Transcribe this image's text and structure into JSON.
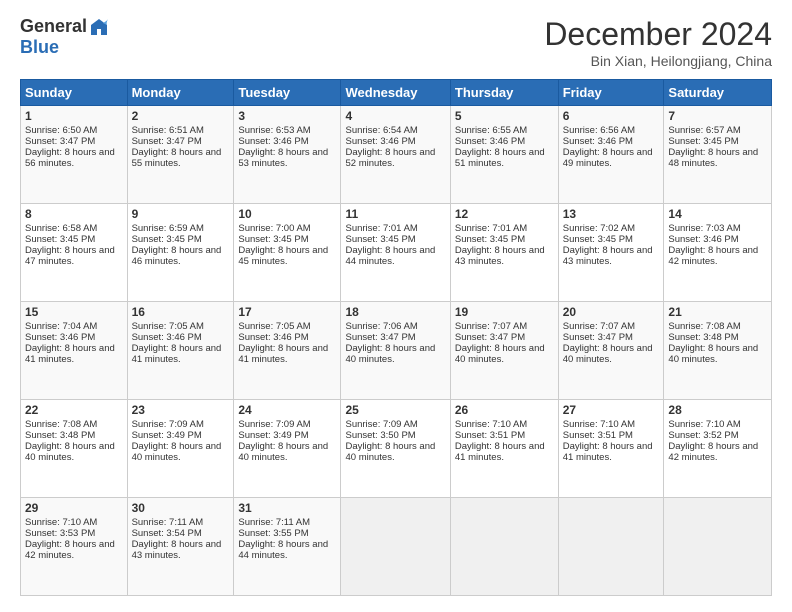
{
  "logo": {
    "general": "General",
    "blue": "Blue"
  },
  "header": {
    "month": "December 2024",
    "location": "Bin Xian, Heilongjiang, China"
  },
  "columns": [
    "Sunday",
    "Monday",
    "Tuesday",
    "Wednesday",
    "Thursday",
    "Friday",
    "Saturday"
  ],
  "weeks": [
    [
      {
        "day": "1",
        "sunrise": "Sunrise: 6:50 AM",
        "sunset": "Sunset: 3:47 PM",
        "daylight": "Daylight: 8 hours and 56 minutes."
      },
      {
        "day": "2",
        "sunrise": "Sunrise: 6:51 AM",
        "sunset": "Sunset: 3:47 PM",
        "daylight": "Daylight: 8 hours and 55 minutes."
      },
      {
        "day": "3",
        "sunrise": "Sunrise: 6:53 AM",
        "sunset": "Sunset: 3:46 PM",
        "daylight": "Daylight: 8 hours and 53 minutes."
      },
      {
        "day": "4",
        "sunrise": "Sunrise: 6:54 AM",
        "sunset": "Sunset: 3:46 PM",
        "daylight": "Daylight: 8 hours and 52 minutes."
      },
      {
        "day": "5",
        "sunrise": "Sunrise: 6:55 AM",
        "sunset": "Sunset: 3:46 PM",
        "daylight": "Daylight: 8 hours and 51 minutes."
      },
      {
        "day": "6",
        "sunrise": "Sunrise: 6:56 AM",
        "sunset": "Sunset: 3:46 PM",
        "daylight": "Daylight: 8 hours and 49 minutes."
      },
      {
        "day": "7",
        "sunrise": "Sunrise: 6:57 AM",
        "sunset": "Sunset: 3:45 PM",
        "daylight": "Daylight: 8 hours and 48 minutes."
      }
    ],
    [
      {
        "day": "8",
        "sunrise": "Sunrise: 6:58 AM",
        "sunset": "Sunset: 3:45 PM",
        "daylight": "Daylight: 8 hours and 47 minutes."
      },
      {
        "day": "9",
        "sunrise": "Sunrise: 6:59 AM",
        "sunset": "Sunset: 3:45 PM",
        "daylight": "Daylight: 8 hours and 46 minutes."
      },
      {
        "day": "10",
        "sunrise": "Sunrise: 7:00 AM",
        "sunset": "Sunset: 3:45 PM",
        "daylight": "Daylight: 8 hours and 45 minutes."
      },
      {
        "day": "11",
        "sunrise": "Sunrise: 7:01 AM",
        "sunset": "Sunset: 3:45 PM",
        "daylight": "Daylight: 8 hours and 44 minutes."
      },
      {
        "day": "12",
        "sunrise": "Sunrise: 7:01 AM",
        "sunset": "Sunset: 3:45 PM",
        "daylight": "Daylight: 8 hours and 43 minutes."
      },
      {
        "day": "13",
        "sunrise": "Sunrise: 7:02 AM",
        "sunset": "Sunset: 3:45 PM",
        "daylight": "Daylight: 8 hours and 43 minutes."
      },
      {
        "day": "14",
        "sunrise": "Sunrise: 7:03 AM",
        "sunset": "Sunset: 3:46 PM",
        "daylight": "Daylight: 8 hours and 42 minutes."
      }
    ],
    [
      {
        "day": "15",
        "sunrise": "Sunrise: 7:04 AM",
        "sunset": "Sunset: 3:46 PM",
        "daylight": "Daylight: 8 hours and 41 minutes."
      },
      {
        "day": "16",
        "sunrise": "Sunrise: 7:05 AM",
        "sunset": "Sunset: 3:46 PM",
        "daylight": "Daylight: 8 hours and 41 minutes."
      },
      {
        "day": "17",
        "sunrise": "Sunrise: 7:05 AM",
        "sunset": "Sunset: 3:46 PM",
        "daylight": "Daylight: 8 hours and 41 minutes."
      },
      {
        "day": "18",
        "sunrise": "Sunrise: 7:06 AM",
        "sunset": "Sunset: 3:47 PM",
        "daylight": "Daylight: 8 hours and 40 minutes."
      },
      {
        "day": "19",
        "sunrise": "Sunrise: 7:07 AM",
        "sunset": "Sunset: 3:47 PM",
        "daylight": "Daylight: 8 hours and 40 minutes."
      },
      {
        "day": "20",
        "sunrise": "Sunrise: 7:07 AM",
        "sunset": "Sunset: 3:47 PM",
        "daylight": "Daylight: 8 hours and 40 minutes."
      },
      {
        "day": "21",
        "sunrise": "Sunrise: 7:08 AM",
        "sunset": "Sunset: 3:48 PM",
        "daylight": "Daylight: 8 hours and 40 minutes."
      }
    ],
    [
      {
        "day": "22",
        "sunrise": "Sunrise: 7:08 AM",
        "sunset": "Sunset: 3:48 PM",
        "daylight": "Daylight: 8 hours and 40 minutes."
      },
      {
        "day": "23",
        "sunrise": "Sunrise: 7:09 AM",
        "sunset": "Sunset: 3:49 PM",
        "daylight": "Daylight: 8 hours and 40 minutes."
      },
      {
        "day": "24",
        "sunrise": "Sunrise: 7:09 AM",
        "sunset": "Sunset: 3:49 PM",
        "daylight": "Daylight: 8 hours and 40 minutes."
      },
      {
        "day": "25",
        "sunrise": "Sunrise: 7:09 AM",
        "sunset": "Sunset: 3:50 PM",
        "daylight": "Daylight: 8 hours and 40 minutes."
      },
      {
        "day": "26",
        "sunrise": "Sunrise: 7:10 AM",
        "sunset": "Sunset: 3:51 PM",
        "daylight": "Daylight: 8 hours and 41 minutes."
      },
      {
        "day": "27",
        "sunrise": "Sunrise: 7:10 AM",
        "sunset": "Sunset: 3:51 PM",
        "daylight": "Daylight: 8 hours and 41 minutes."
      },
      {
        "day": "28",
        "sunrise": "Sunrise: 7:10 AM",
        "sunset": "Sunset: 3:52 PM",
        "daylight": "Daylight: 8 hours and 42 minutes."
      }
    ],
    [
      {
        "day": "29",
        "sunrise": "Sunrise: 7:10 AM",
        "sunset": "Sunset: 3:53 PM",
        "daylight": "Daylight: 8 hours and 42 minutes."
      },
      {
        "day": "30",
        "sunrise": "Sunrise: 7:11 AM",
        "sunset": "Sunset: 3:54 PM",
        "daylight": "Daylight: 8 hours and 43 minutes."
      },
      {
        "day": "31",
        "sunrise": "Sunrise: 7:11 AM",
        "sunset": "Sunset: 3:55 PM",
        "daylight": "Daylight: 8 hours and 44 minutes."
      },
      null,
      null,
      null,
      null
    ]
  ]
}
